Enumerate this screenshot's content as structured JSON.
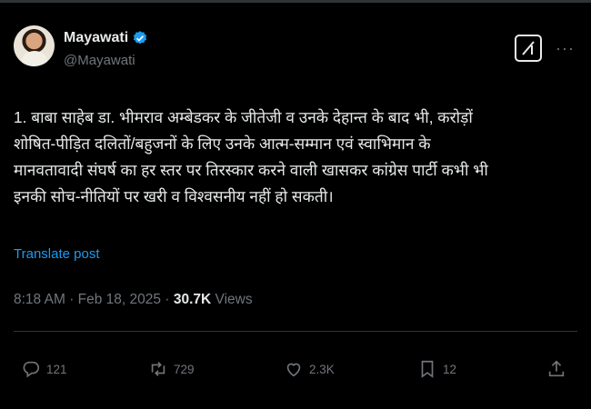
{
  "author": {
    "name": "Mayawati",
    "handle": "@Mayawati",
    "verified": true
  },
  "post": {
    "text": "1. बाबा साहेब डा. भीमराव अम्बेडकर के जीतेजी व उनके देहान्त के बाद भी, करोड़ों\nशोषित-पीड़ित दलितों/बहुजनों के लिए उनके आत्म-सम्मान एवं स्वाभिमान के\nमानवतावादी संघर्ष का हर स्तर पर तिरस्कार करने वाली खासकर कांग्रेस पार्टी कभी भी\nइनकी सोच-नीतियों पर खरी व विश्वसनीय नहीं हो सकती।",
    "translate_label": "Translate post",
    "time": "8:18 AM",
    "separator": "·",
    "date": "Feb 18, 2025",
    "views_count": "30.7K",
    "views_label": "Views"
  },
  "actions": {
    "replies": "121",
    "reposts": "729",
    "likes": "2.3K",
    "bookmarks": "12"
  },
  "icons": [
    "verified-badge-icon",
    "grok-icon",
    "more-icon",
    "reply-icon",
    "repost-icon",
    "like-icon",
    "bookmark-icon",
    "share-icon"
  ],
  "colors": {
    "background": "#000000",
    "text": "#e7e9ea",
    "muted": "#71767b",
    "accent": "#1d9bf0"
  }
}
